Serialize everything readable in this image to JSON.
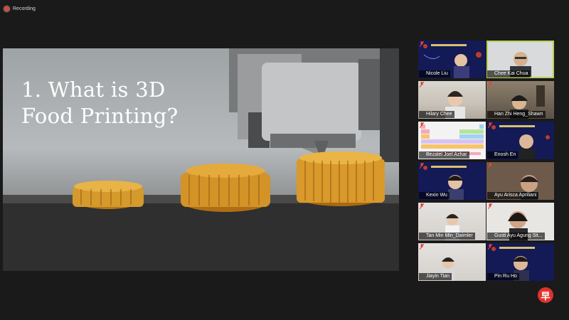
{
  "recording": {
    "label": "Recording"
  },
  "slide": {
    "title_line1": "1. What is 3D",
    "title_line2": "Food Printing?"
  },
  "participants": [
    {
      "name": "Nicole Liu"
    },
    {
      "name": "Chee Kai Chua"
    },
    {
      "name": "Hilary Chee"
    },
    {
      "name": "Han Zhi Heng_Shawn"
    },
    {
      "name": "Bezalel Joel Azhar"
    },
    {
      "name": "Enosh En"
    },
    {
      "name": "Kexin Wu"
    },
    {
      "name": "Ayu Arisca Apriliani"
    },
    {
      "name": "Tan Min Min_Daimler"
    },
    {
      "name": "Gusti Ayu Agung Sit..."
    },
    {
      "name": "Jiayin Tian"
    },
    {
      "name": "Pin Ru Ho"
    }
  ],
  "brand": {
    "logo_char": "早"
  },
  "colors": {
    "active_speaker": "#b7d25a",
    "recording": "#e0463a",
    "logo": "#e0322d"
  }
}
